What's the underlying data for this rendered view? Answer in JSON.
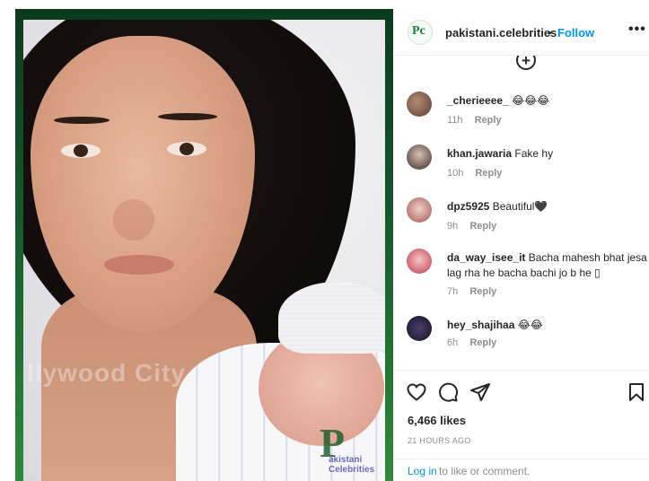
{
  "header": {
    "username": "pakistani.celebrities",
    "separator": "•",
    "follow_label": "Follow",
    "more_label": "•••",
    "avatar_letter": "Pc"
  },
  "media": {
    "watermark_text": "llywood City",
    "logo_letter": "P",
    "logo_text": "akistani Celebrities"
  },
  "comments": {
    "load_more_icon": "plus-circle-icon",
    "items": [
      {
        "user": "_cherieeee_",
        "text": "😂😂😂",
        "time": "11h",
        "reply": "Reply"
      },
      {
        "user": "khan.jawaria",
        "text": "Fake hy",
        "time": "10h",
        "reply": "Reply"
      },
      {
        "user": "dpz5925",
        "text": "Beautiful🖤",
        "time": "9h",
        "reply": "Reply"
      },
      {
        "user": "da_way_isee_it",
        "text": "Bacha mahesh bhat jesa lag rha he bacha bachi jo b he ▯",
        "time": "7h",
        "reply": "Reply"
      },
      {
        "user": "hey_shajihaa",
        "text": "😂😂",
        "time": "6h",
        "reply": "Reply"
      }
    ]
  },
  "actions": {
    "icons": [
      "heart-icon",
      "comment-icon",
      "share-icon",
      "bookmark-icon"
    ],
    "likes": "6,466 likes",
    "timestamp": "21 HOURS AGO",
    "login_link": "Log in",
    "login_rest": "to like or comment."
  }
}
